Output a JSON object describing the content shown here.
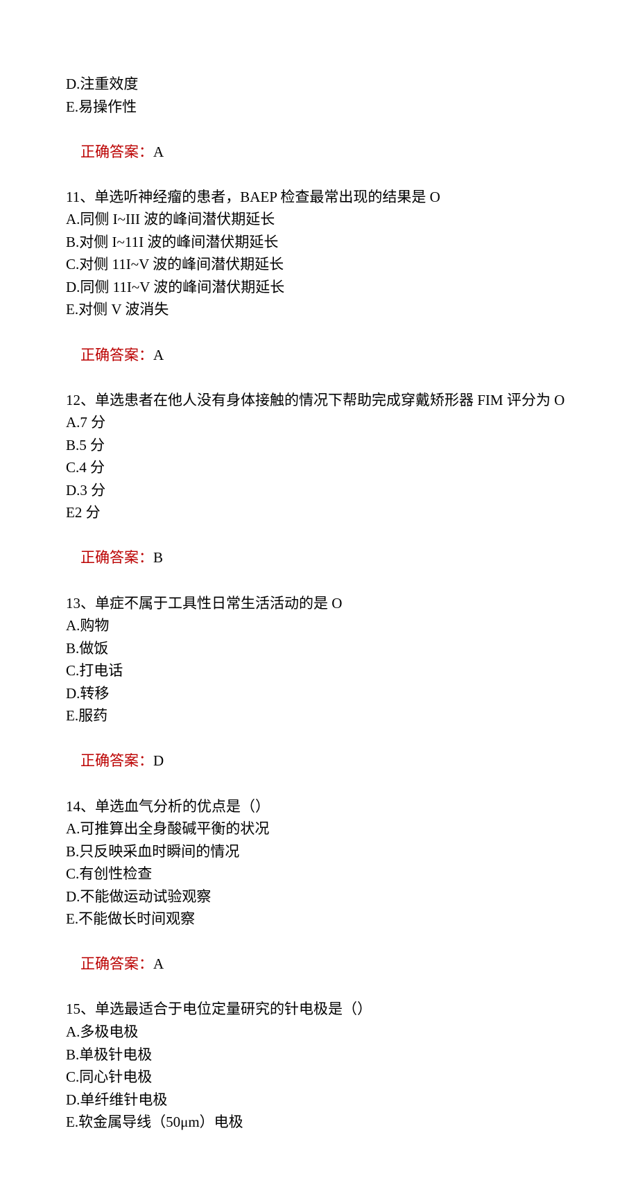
{
  "preLines": [
    "D.注重效度",
    "E.易操作性"
  ],
  "preAnswer": {
    "label": "正确答案：",
    "value": "A"
  },
  "questions": [
    {
      "stem": "11、单选听神经瘤的患者，BAEP 检查最常出现的结果是 O",
      "options": [
        "A.同侧 I~III 波的峰间潜伏期延长",
        "B.对侧 I~11I 波的峰间潜伏期延长",
        "C.对侧 11I~V 波的峰间潜伏期延长",
        "D.同侧 11I~V 波的峰间潜伏期延长",
        "E.对侧 V 波消失"
      ],
      "answer": {
        "label": "正确答案：",
        "value": "A"
      }
    },
    {
      "stem": "12、单选患者在他人没有身体接触的情况下帮助完成穿戴矫形器 FIM 评分为 O",
      "options": [
        "A.7 分",
        "B.5 分",
        "C.4 分",
        "D.3 分",
        "E2 分"
      ],
      "answer": {
        "label": "正确答案：",
        "value": "B"
      }
    },
    {
      "stem": "13、单症不属于工具性日常生活活动的是 O",
      "options": [
        "A.购物",
        "B.做饭",
        "C.打电话",
        "D.转移",
        "E.服药"
      ],
      "answer": {
        "label": "正确答案：",
        "value": "D"
      }
    },
    {
      "stem": "14、单选血气分析的优点是（）",
      "options": [
        "A.可推算出全身酸碱平衡的状况",
        "B.只反映采血时瞬间的情况",
        "C.有创性检查",
        "D.不能做运动试验观察",
        "E.不能做长时间观察"
      ],
      "answer": {
        "label": "正确答案：",
        "value": "A"
      }
    },
    {
      "stem": "15、单选最适合于电位定量研究的针电极是（）",
      "options": [
        "A.多极电极",
        "B.单极针电极",
        "C.同心针电极",
        "D.单纤维针电极",
        "E.软金属导线（50μm）电极"
      ],
      "answer": null
    }
  ]
}
